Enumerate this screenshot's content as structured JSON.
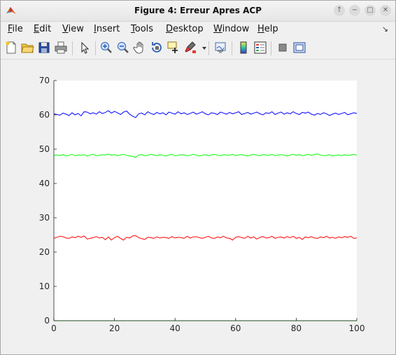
{
  "window": {
    "title": "Figure 4: Erreur Apres ACP"
  },
  "menu": {
    "items": [
      {
        "label": "File",
        "u": "F",
        "rest": "ile"
      },
      {
        "label": "Edit",
        "u": "E",
        "rest": "dit"
      },
      {
        "label": "View",
        "u": "V",
        "rest": "iew"
      },
      {
        "label": "Insert",
        "u": "I",
        "rest": "nsert"
      },
      {
        "label": "Tools",
        "u": "T",
        "rest": "ools"
      },
      {
        "label": "Desktop",
        "u": "D",
        "rest": "esktop"
      },
      {
        "label": "Window",
        "u": "W",
        "rest": "indow"
      },
      {
        "label": "Help",
        "u": "H",
        "rest": "elp"
      }
    ]
  },
  "toolbar": {
    "icons": [
      "new-figure-icon",
      "open-icon",
      "save-icon",
      "print-icon",
      "select-arrow-icon",
      "zoom-in-icon",
      "zoom-out-icon",
      "pan-hand-icon",
      "rotate-3d-icon",
      "data-cursor-icon",
      "brush-icon",
      "brush-dropdown-icon",
      "link-plot-icon",
      "colorbar-icon",
      "legend-icon",
      "hide-plot-tools-icon",
      "show-plot-tools-icon"
    ]
  },
  "chart_data": {
    "type": "line",
    "xlim": [
      0,
      100
    ],
    "ylim": [
      0,
      70
    ],
    "xticks": [
      0,
      20,
      40,
      60,
      80,
      100
    ],
    "yticks": [
      0,
      10,
      20,
      30,
      40,
      50,
      60,
      70
    ],
    "grid": false,
    "series": [
      {
        "color": "#0000ff",
        "values": [
          60.3,
          60.1,
          59.9,
          60.5,
          60.2,
          59.8,
          60.6,
          60.0,
          60.4,
          59.7,
          60.9,
          60.8,
          60.3,
          60.6,
          60.2,
          60.9,
          60.4,
          60.7,
          61.2,
          60.5,
          61.0,
          60.6,
          60.1,
          60.8,
          61.1,
          60.2,
          59.6,
          59.2,
          60.3,
          60.5,
          60.0,
          60.9,
          60.4,
          60.1,
          60.7,
          60.3,
          60.6,
          60.0,
          60.8,
          60.5,
          60.2,
          60.9,
          60.3,
          60.6,
          60.1,
          60.4,
          60.8,
          60.2,
          60.5,
          60.9,
          60.3,
          60.0,
          60.6,
          60.4,
          60.1,
          60.8,
          60.5,
          60.2,
          60.7,
          60.3,
          60.6,
          60.9,
          60.1,
          60.4,
          60.7,
          60.2,
          60.5,
          60.8,
          60.3,
          60.0,
          60.6,
          60.4,
          60.9,
          60.1,
          60.5,
          60.8,
          60.2,
          60.6,
          60.3,
          60.9,
          60.4,
          60.1,
          60.7,
          60.5,
          60.8,
          60.2,
          59.9,
          60.4,
          60.1,
          60.6,
          60.3,
          59.8,
          60.2,
          60.5,
          60.1,
          60.4,
          60.7,
          60.0,
          60.3,
          60.6,
          60.4
        ]
      },
      {
        "color": "#00ff00",
        "values": [
          48.2,
          48.3,
          48.1,
          48.4,
          48.0,
          48.2,
          48.5,
          48.1,
          48.3,
          48.2,
          48.4,
          48.0,
          48.3,
          48.5,
          48.1,
          48.2,
          48.4,
          48.3,
          48.6,
          48.2,
          48.4,
          48.1,
          48.3,
          48.5,
          48.2,
          48.0,
          47.9,
          47.6,
          48.3,
          48.4,
          48.1,
          48.2,
          48.5,
          48.3,
          48.1,
          48.4,
          48.2,
          48.0,
          48.3,
          48.5,
          48.1,
          48.2,
          48.4,
          48.3,
          48.1,
          48.2,
          48.5,
          48.3,
          48.0,
          48.2,
          48.4,
          48.1,
          48.3,
          48.5,
          48.2,
          48.1,
          48.4,
          48.3,
          48.2,
          48.5,
          48.1,
          48.3,
          48.4,
          48.2,
          48.0,
          48.3,
          48.5,
          48.2,
          48.1,
          48.4,
          48.3,
          48.2,
          48.5,
          48.1,
          48.3,
          48.4,
          48.2,
          48.0,
          48.3,
          48.5,
          48.2,
          48.4,
          48.1,
          48.3,
          48.5,
          48.2,
          48.4,
          48.6,
          48.3,
          48.1,
          48.2,
          48.4,
          48.0,
          48.2,
          48.3,
          48.1,
          48.4,
          48.2,
          48.3,
          48.5,
          48.2
        ]
      },
      {
        "color": "#ff0000",
        "values": [
          24.0,
          24.3,
          24.6,
          24.5,
          24.1,
          24.0,
          24.4,
          24.2,
          24.6,
          24.3,
          24.7,
          23.8,
          24.0,
          24.2,
          24.5,
          24.1,
          24.3,
          23.6,
          24.4,
          23.5,
          24.2,
          24.6,
          24.0,
          23.5,
          24.3,
          24.1,
          24.7,
          24.8,
          24.2,
          23.9,
          23.7,
          24.3,
          24.2,
          24.0,
          24.4,
          24.1,
          24.3,
          24.2,
          24.0,
          24.5,
          24.1,
          24.3,
          24.2,
          24.0,
          24.6,
          24.1,
          24.4,
          24.5,
          24.2,
          24.0,
          24.3,
          24.6,
          24.1,
          24.0,
          24.4,
          24.2,
          24.6,
          24.1,
          24.0,
          23.5,
          24.3,
          24.5,
          24.2,
          24.0,
          24.6,
          24.1,
          24.4,
          23.8,
          24.3,
          24.5,
          24.1,
          24.2,
          24.6,
          24.0,
          24.3,
          24.4,
          24.1,
          24.5,
          24.2,
          24.6,
          24.0,
          24.3,
          23.7,
          24.4,
          24.2,
          24.5,
          24.1,
          24.0,
          24.4,
          24.2,
          24.6,
          24.1,
          24.3,
          24.0,
          24.4,
          24.2,
          24.5,
          24.3,
          24.6,
          24.0,
          24.1
        ]
      },
      {
        "color": "#00c000",
        "values": [
          0,
          0,
          0,
          0,
          0,
          0,
          0,
          0,
          0,
          0,
          0,
          0,
          0,
          0,
          0,
          0,
          0,
          0,
          0,
          0,
          0,
          0,
          0,
          0,
          0,
          0,
          0,
          0,
          0,
          0,
          0,
          0,
          0,
          0,
          0,
          0,
          0,
          0,
          0,
          0,
          0,
          0,
          0,
          0,
          0,
          0,
          0,
          0,
          0,
          0,
          0,
          0,
          0,
          0,
          0,
          0,
          0,
          0,
          0,
          0,
          0,
          0,
          0,
          0,
          0,
          0,
          0,
          0,
          0,
          0,
          0,
          0,
          0,
          0,
          0,
          0,
          0,
          0,
          0,
          0,
          0,
          0,
          0,
          0,
          0,
          0,
          0,
          0,
          0,
          0,
          0,
          0,
          0,
          0,
          0,
          0,
          0,
          0,
          0,
          0,
          0
        ]
      }
    ]
  }
}
